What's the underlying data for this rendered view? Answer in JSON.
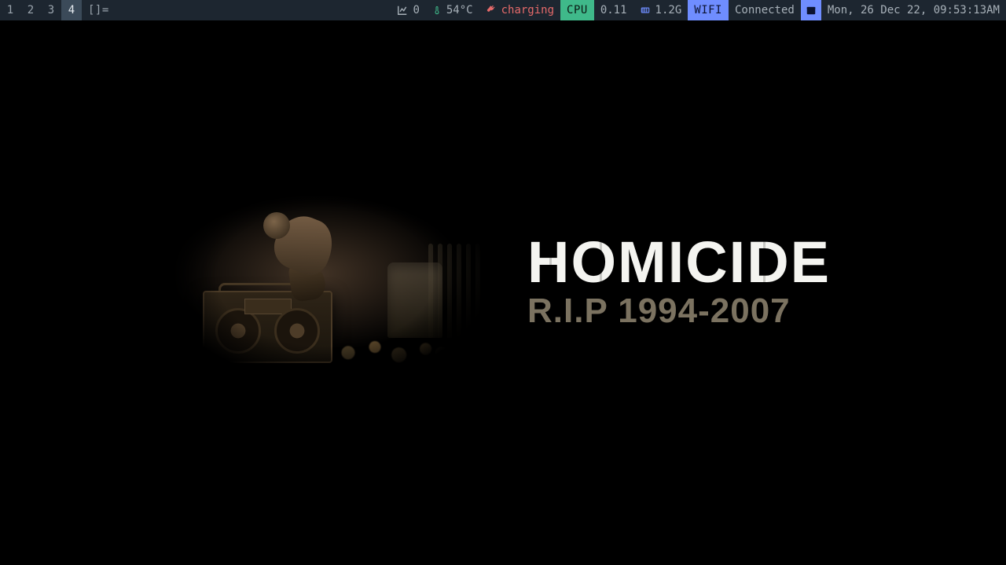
{
  "workspaces": {
    "items": [
      "1",
      "2",
      "3",
      "4"
    ],
    "active_index": 3
  },
  "layout_indicator": "[]=",
  "status": {
    "updates": {
      "value": "0"
    },
    "temp": {
      "value": "54°C"
    },
    "battery": {
      "value": "charging"
    },
    "cpu": {
      "label": "CPU",
      "value": "0.11"
    },
    "mem": {
      "value": "1.2G"
    },
    "wifi": {
      "label": "WIFI",
      "value": "Connected"
    },
    "datetime": {
      "value": "Mon, 26 Dec 22, 09:53:13AM"
    }
  },
  "wallpaper": {
    "title": "HOMICIDE",
    "subtitle": "R.I.P 1994-2007"
  }
}
